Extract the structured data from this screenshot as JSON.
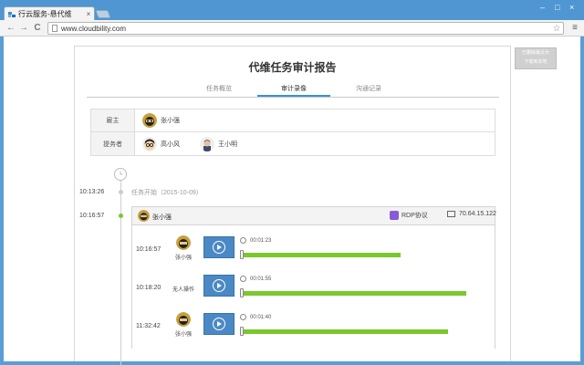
{
  "browser": {
    "tab_title": "行云服务-悬代维",
    "tab_close": "×",
    "url": "www.cloudbility.com",
    "star": "☆",
    "menu": "≡",
    "back": "←",
    "forward": "→",
    "reload": "C",
    "minimize": "–",
    "maximize": "□",
    "close": "×"
  },
  "report": {
    "title": "代维任务审计报告",
    "tabs": [
      {
        "label": "任务概览"
      },
      {
        "label": "审计录像"
      },
      {
        "label": "沟通记录"
      }
    ],
    "owner_label": "雇主",
    "owner_name": "张小强",
    "provider_label": "提务者",
    "providers": [
      {
        "name": "高小风"
      },
      {
        "name": "王小明"
      }
    ]
  },
  "timeline": {
    "start_time": "10:13:26",
    "start_text": "任务开始（2015-10-09）",
    "session_time": "10:16:57",
    "session": {
      "user": "张小强",
      "protocol": "RDP协议",
      "ip": "70.64.15.122",
      "records": [
        {
          "time": "10:16:57",
          "user": "张小强",
          "duration": "00:01:23",
          "progress": 0.69
        },
        {
          "time": "10:18:20",
          "user": "无人操作",
          "duration": "00:01:55",
          "progress": 0.98
        },
        {
          "time": "11:32:42",
          "user": "张小强",
          "duration": "00:01:40",
          "progress": 0.9
        }
      ]
    }
  },
  "side_button": {
    "line1": "已删除最近大",
    "line2": "下载到本地"
  },
  "colors": {
    "accent": "#3a8fd6",
    "progress": "#7ac72e",
    "play": "#4a89c5",
    "rdp": "#8a5ad6"
  }
}
